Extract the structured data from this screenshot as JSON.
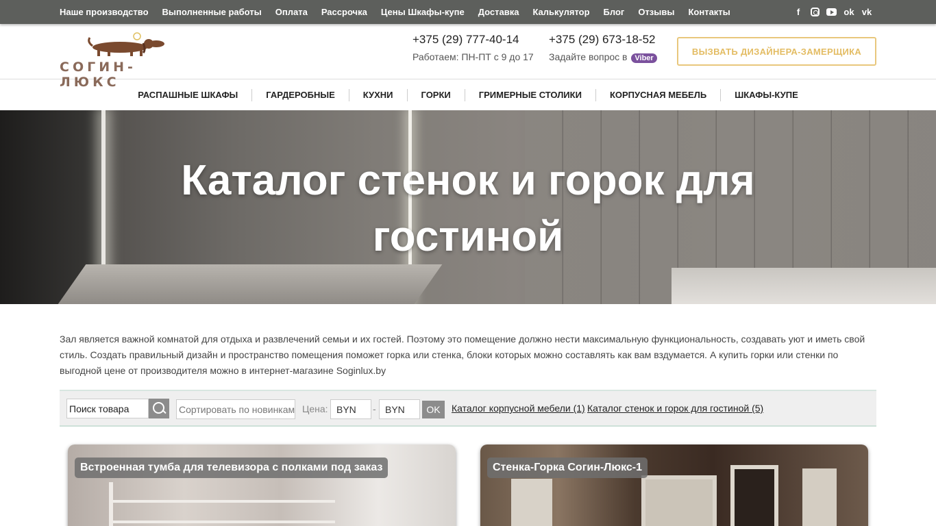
{
  "topnav": {
    "items": [
      "Наше производство",
      "Выполненные работы",
      "Оплата",
      "Рассрочка",
      "Цены Шкафы-купе",
      "Доставка",
      "Калькулятор",
      "Блог",
      "Отзывы",
      "Контакты"
    ],
    "social_icons": [
      "facebook-icon",
      "instagram-icon",
      "youtube-icon",
      "odnoklassniki-icon",
      "vk-icon"
    ],
    "social_glyphs": {
      "facebook": "f",
      "odnoklassniki": "ok",
      "vk": "vk"
    }
  },
  "header": {
    "logo_text": "СОГИН-ЛЮКС",
    "phone1": "+375 (29) 777-40-14",
    "phone1_sub": "Работаем: ПН-ПТ с 9 до 17",
    "phone2": "+375 (29) 673-18-52",
    "phone2_sub": "Задайте вопрос в",
    "viber_label": "Viber",
    "cta_label": "ВЫЗВАТЬ ДИЗАЙНЕРА-ЗАМЕРЩИКА"
  },
  "catnav": {
    "items": [
      "РАСПАШНЫЕ ШКАФЫ",
      "ГАРДЕРОБНЫЕ",
      "КУХНИ",
      "ГОРКИ",
      "ГРИМЕРНЫЕ СТОЛИКИ",
      "КОРПУСНАЯ МЕБЕЛЬ",
      "ШКАФЫ-КУПЕ"
    ]
  },
  "hero": {
    "title_line1": "Каталог стенок и горок для",
    "title_line2": "гостиной"
  },
  "intro": {
    "text": "Зал является важной комнатой для отдыха и развлечений семьи и их гостей. Поэтому это помещение должно нести максимальную функциональность, создавать уют и иметь свой стиль. Создать правильный дизайн и пространство помещения поможет горка или стенка, блоки которых можно составлять как вам вздумается. А купить горки или стенки по выгодной цене от производителя можно в интернет-магазине Soginlux.by"
  },
  "filter": {
    "search_value": "Поиск товара",
    "sort_value": "Сортировать по новинкам",
    "price_label": "Цена:",
    "currency_from": "BYN",
    "currency_to": "BYN",
    "dash": "-",
    "ok_label": "OK",
    "category1": "Каталог корпусной мебели (1)",
    "category2": "Каталог стенок и горок для гостиной (5)"
  },
  "products": [
    {
      "name": "Встроенная тумба для телевизора с полками под заказ"
    },
    {
      "name": "Стенка-Горка Согин-Люкс-1"
    }
  ],
  "colors": {
    "topbar": "#5d5f5c",
    "cta": "#e3bc63",
    "viber": "#7b519d",
    "filter_bg": "#efefef"
  }
}
